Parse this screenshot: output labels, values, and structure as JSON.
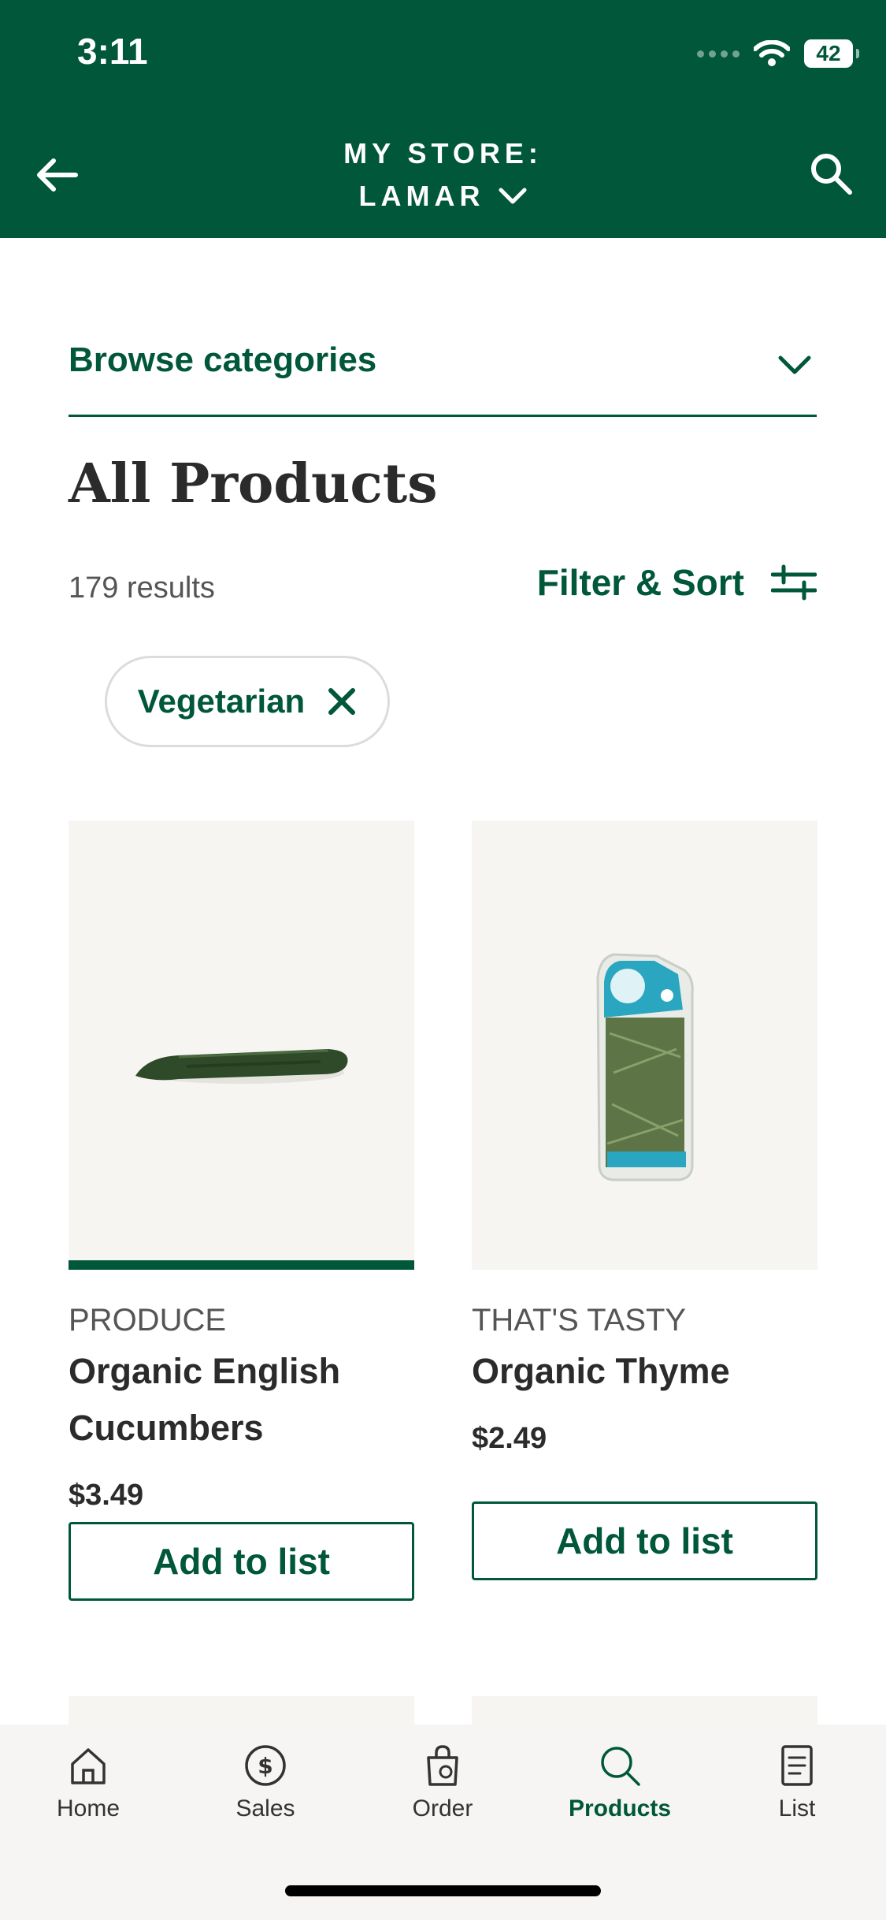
{
  "status_bar": {
    "time": "3:11",
    "battery": "42"
  },
  "header": {
    "store_label": "MY STORE:",
    "store_name": "LAMAR",
    "back_icon": "arrow-left-icon",
    "search_icon": "search-icon"
  },
  "browse": {
    "label": "Browse categories",
    "icon": "chevron-down-icon"
  },
  "page": {
    "title": "All Products",
    "results_count": "179 results",
    "filter_label": "Filter & Sort"
  },
  "active_filter": {
    "label": "Vegetarian",
    "icon": "close-icon"
  },
  "products": [
    {
      "brand": "PRODUCE",
      "name": "Organic English Cucumbers",
      "price": "$3.49",
      "button": "Add to list"
    },
    {
      "brand": "THAT'S TASTY",
      "name": "Organic Thyme",
      "price": "$2.49",
      "button": "Add to list"
    }
  ],
  "tabs": [
    {
      "label": "Home",
      "icon": "home-icon"
    },
    {
      "label": "Sales",
      "icon": "dollar-icon"
    },
    {
      "label": "Order",
      "icon": "shopping-bag-icon"
    },
    {
      "label": "Products",
      "icon": "search-icon",
      "active": true
    },
    {
      "label": "List",
      "icon": "list-icon"
    }
  ],
  "colors": {
    "brand_green": "#00573a",
    "panel_bg": "#f6f5f2"
  }
}
